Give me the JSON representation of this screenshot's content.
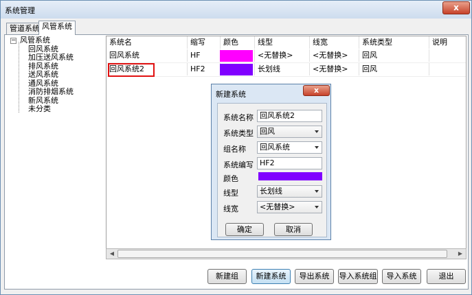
{
  "window": {
    "title": "系统管理",
    "close_label": "x"
  },
  "tabs": [
    {
      "label": "管道系统",
      "active": false
    },
    {
      "label": "风管系统",
      "active": true
    }
  ],
  "tree": {
    "expander": "−",
    "root": "风管系统",
    "children": [
      "回风系统",
      "加压送风系统",
      "排风系统",
      "送风系统",
      "通风系统",
      "消防排烟系统",
      "新风系统",
      "未分类"
    ]
  },
  "grid": {
    "columns": [
      "系统名",
      "缩写",
      "颜色",
      "线型",
      "线宽",
      "系统类型",
      "说明"
    ],
    "rows": [
      {
        "name": "回风系统",
        "abbr": "HF",
        "color": "#ff00ff",
        "linetype": "<无替换>",
        "linewidth": "<无替换>",
        "type": "回风",
        "desc": ""
      },
      {
        "name": "回风系统2",
        "abbr": "HF2",
        "color": "#8000ff",
        "linetype": "长划线",
        "linewidth": "<无替换>",
        "type": "回风",
        "desc": ""
      }
    ]
  },
  "dialog": {
    "title": "新建系统",
    "close_label": "x",
    "fields": {
      "name_label": "系统名称",
      "name_value": "回风系统2",
      "type_label": "系统类型",
      "type_value": "回风",
      "group_label": "组名称",
      "group_value": "回风系统",
      "abbr_label": "系统编写",
      "abbr_value": "HF2",
      "color_label": "颜色",
      "color_value": "#8000ff",
      "linetype_label": "线型",
      "linetype_value": "长划线",
      "linewidth_label": "线宽",
      "linewidth_value": "<无替换>"
    },
    "ok_label": "确定",
    "cancel_label": "取消"
  },
  "buttons": {
    "new_group": "新建组",
    "new_system": "新建系统",
    "export_system": "导出系统",
    "import_group": "导入系统组",
    "import_system": "导入系统",
    "exit": "退出"
  }
}
